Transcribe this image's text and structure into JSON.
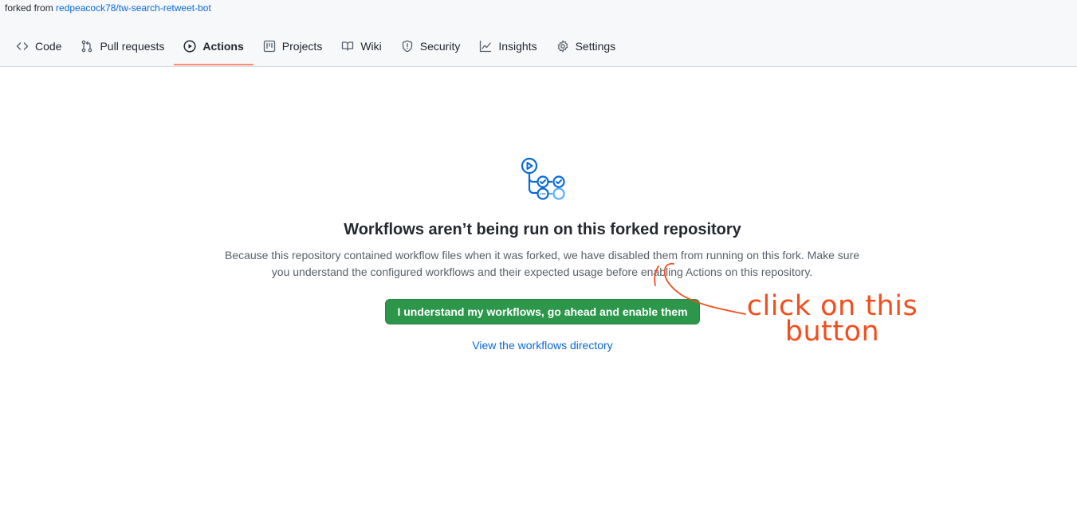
{
  "header": {
    "forked_prefix": "forked from",
    "forked_repo": "redpeacock78/tw-search-retweet-bot",
    "tabs": [
      {
        "label": "Code",
        "icon": "code-icon"
      },
      {
        "label": "Pull requests",
        "icon": "git-pull-request-icon"
      },
      {
        "label": "Actions",
        "icon": "play-icon",
        "active": true
      },
      {
        "label": "Projects",
        "icon": "project-icon"
      },
      {
        "label": "Wiki",
        "icon": "book-icon"
      },
      {
        "label": "Security",
        "icon": "shield-icon"
      },
      {
        "label": "Insights",
        "icon": "graph-icon"
      },
      {
        "label": "Settings",
        "icon": "gear-icon"
      }
    ]
  },
  "main": {
    "icon": "workflow-icon",
    "title": "Workflows aren’t being run on this forked repository",
    "description": "Because this repository contained workflow files when it was forked, we have disabled them from running on this fork. Make sure you understand the configured workflows and their expected usage before enabling Actions on this repository.",
    "enable_button": "I understand my workflows, go ahead and enable them",
    "directory_link": "View the workflows directory"
  },
  "annotation": {
    "line1": "click on this",
    "line2": "button",
    "color": "#f24e1e"
  },
  "colors": {
    "accent_green": "#2c974b",
    "link_blue": "#0969da",
    "active_tab_underline": "#fd8c73"
  }
}
